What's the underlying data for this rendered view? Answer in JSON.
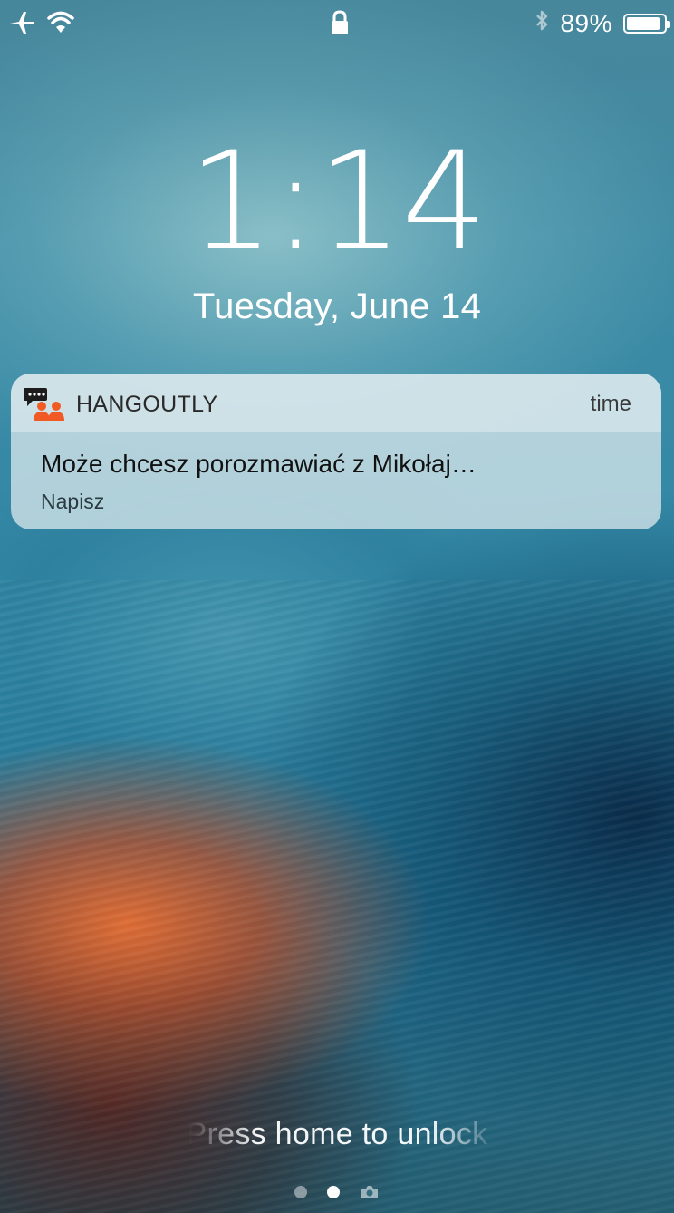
{
  "status_bar": {
    "battery_percent": "89%",
    "battery_level": 0.89,
    "icons": [
      "airplane-icon",
      "wifi-icon",
      "lock-icon",
      "bluetooth-icon",
      "battery-icon"
    ]
  },
  "lock_screen": {
    "time": "1:14",
    "date": "Tuesday, June 14",
    "unlock_hint": "Press home to unlock"
  },
  "notification": {
    "app_name": "HANGOUTLY",
    "time_label": "time",
    "message": "Może chcesz porozmawiać z Mikołaj…",
    "action_label": "Napisz",
    "app_icon": "hangoutly-app-icon",
    "app_icon_accent": "#f15a24"
  },
  "page_indicators": {
    "count": 2,
    "active_index": 1,
    "extra": "camera-icon"
  }
}
